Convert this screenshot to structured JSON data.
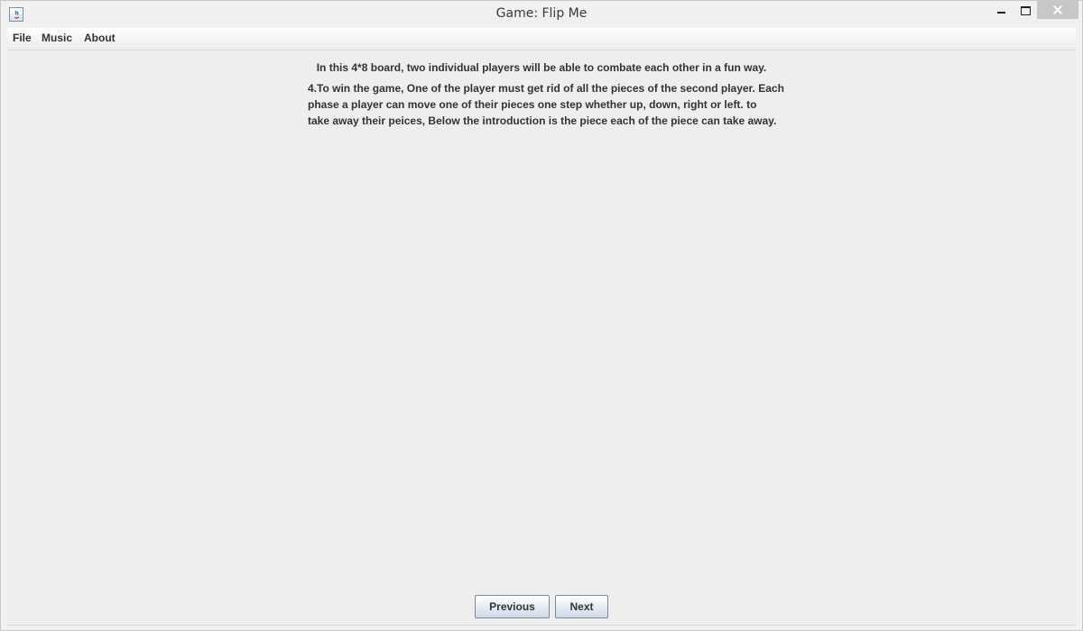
{
  "window": {
    "title": "Game: Flip Me",
    "app_icon": "java-icon"
  },
  "menubar": {
    "items": [
      {
        "label": "File"
      },
      {
        "label": "Music"
      },
      {
        "label": "About"
      }
    ]
  },
  "content": {
    "intro": "In this 4*8 board, two individual players will be able to combate each other in a fun way.",
    "rules": [
      "4.To win the game, One of the player must get rid of all the pieces of the second player. Each",
      "phase a player can move one of their pieces one step whether up, down, right or left. to",
      "take away their peices, Below the introduction is the piece each of the piece can take away."
    ]
  },
  "buttons": {
    "previous_label": "Previous",
    "next_label": "Next"
  },
  "colors": {
    "background": "#f0f0f0",
    "text": "#333333",
    "close_button": "#c7c7c7"
  }
}
